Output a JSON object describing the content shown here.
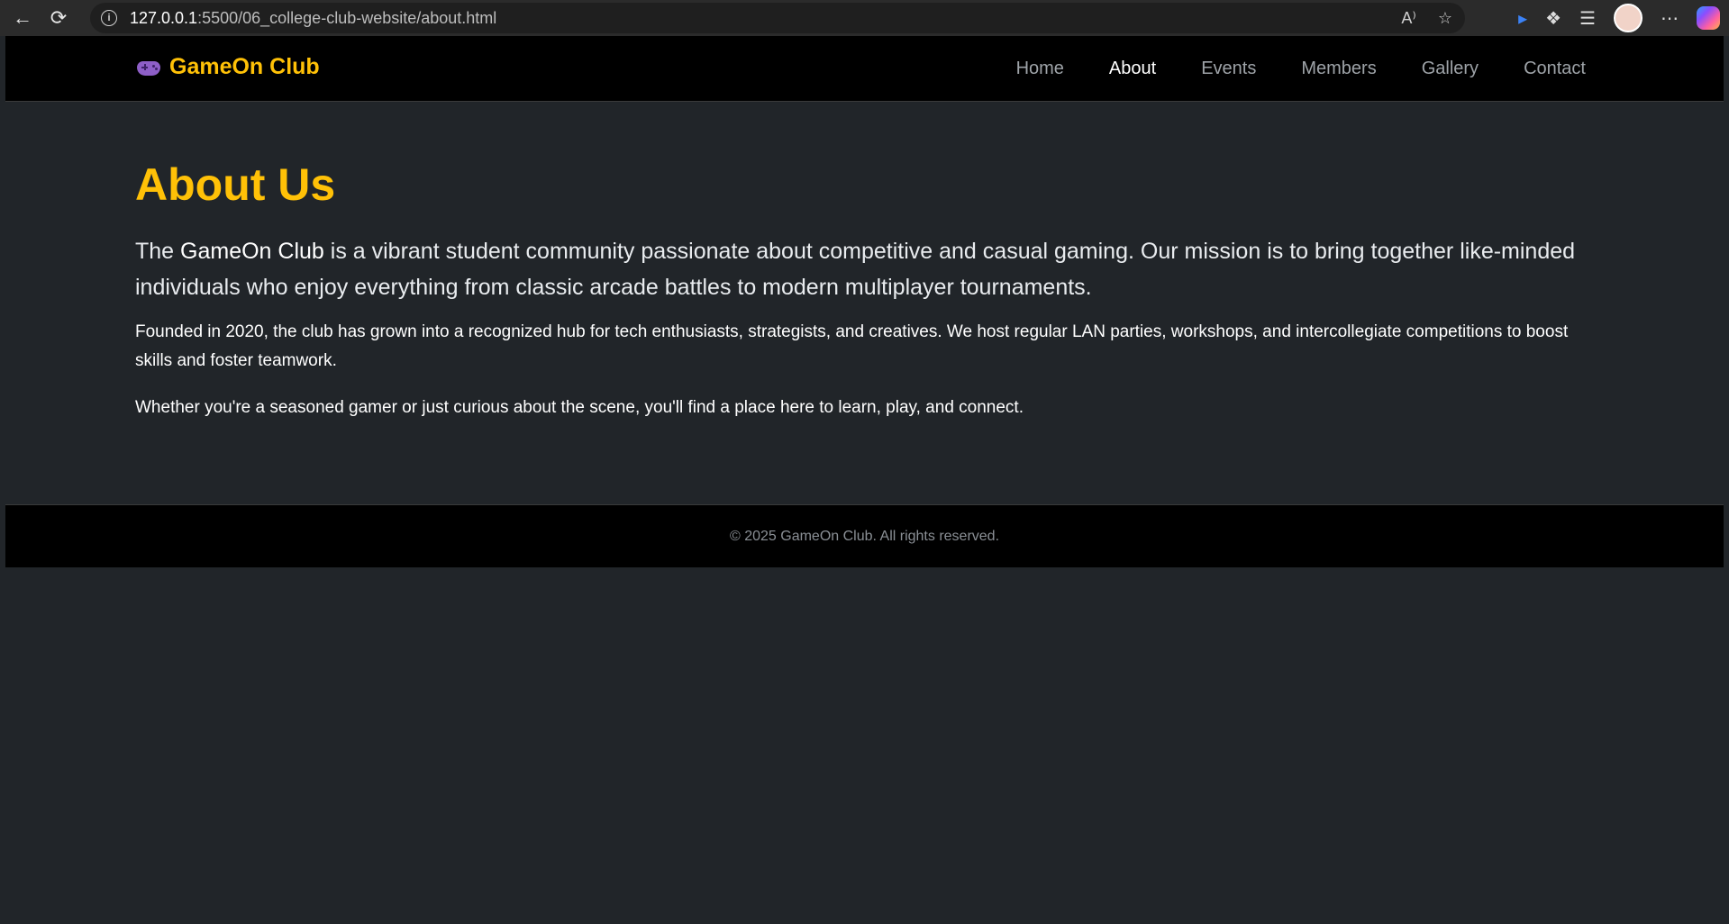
{
  "browser": {
    "url_host": "127.0.0.1",
    "url_rest": ":5500/06_college-club-website/about.html"
  },
  "site": {
    "brand": "GameOn Club",
    "nav": [
      "Home",
      "About",
      "Events",
      "Members",
      "Gallery",
      "Contact"
    ],
    "active_nav": "About"
  },
  "about": {
    "title": "About Us",
    "lead_prefix": "The ",
    "lead_brand": "GameOn Club",
    "lead_rest": " is a vibrant student community passionate about competitive and casual gaming. Our mission is to bring together like-minded individuals who enjoy everything from classic arcade battles to modern multiplayer tournaments.",
    "paragraph1": "Founded in 2020, the club has grown into a recognized hub for tech enthusiasts, strategists, and creatives. We host regular LAN parties, workshops, and intercollegiate competitions to boost skills and foster teamwork.",
    "paragraph2": "Whether you're a seasoned gamer or just curious about the scene, you'll find a place here to learn, play, and connect."
  },
  "footer": {
    "text": "© 2025 GameOn Club. All rights reserved."
  },
  "colors": {
    "accent": "#ffc107",
    "background": "#212529",
    "nav_background": "#000000"
  }
}
